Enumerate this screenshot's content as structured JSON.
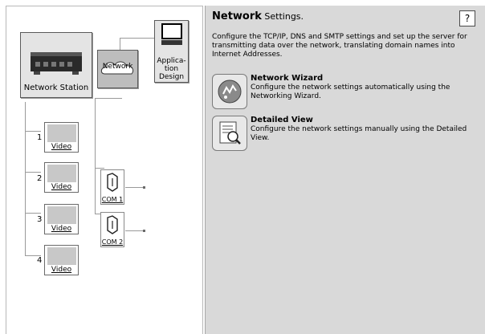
{
  "tree": {
    "network_station": {
      "label": "Network Station"
    },
    "network_cloud": {
      "label": "Network"
    },
    "app_design": {
      "label_lines": [
        "Applica-",
        "tion",
        "Design"
      ]
    },
    "cameras": [
      {
        "number": "1",
        "label": "Video"
      },
      {
        "number": "2",
        "label": "Video"
      },
      {
        "number": "3",
        "label": "Video"
      },
      {
        "number": "4",
        "label": "Video"
      }
    ],
    "com_ports": [
      {
        "label": "COM 1"
      },
      {
        "label": "COM 2"
      }
    ]
  },
  "settings": {
    "title_bold": "Network",
    "title_rest": " Settings.",
    "help_label": "?",
    "intro": "Configure the TCP/IP, DNS and SMTP settings and set up the server for transmitting data over the network, translating domain names into Internet Addresses.",
    "options": [
      {
        "title": "Network Wizard",
        "description": "Configure the network settings automatically using the Networking Wizard.",
        "icon": "wizard-globe-icon"
      },
      {
        "title": "Detailed View",
        "description": "Configure the network settings manually using the Detailed View.",
        "icon": "magnifier-list-icon"
      }
    ]
  }
}
